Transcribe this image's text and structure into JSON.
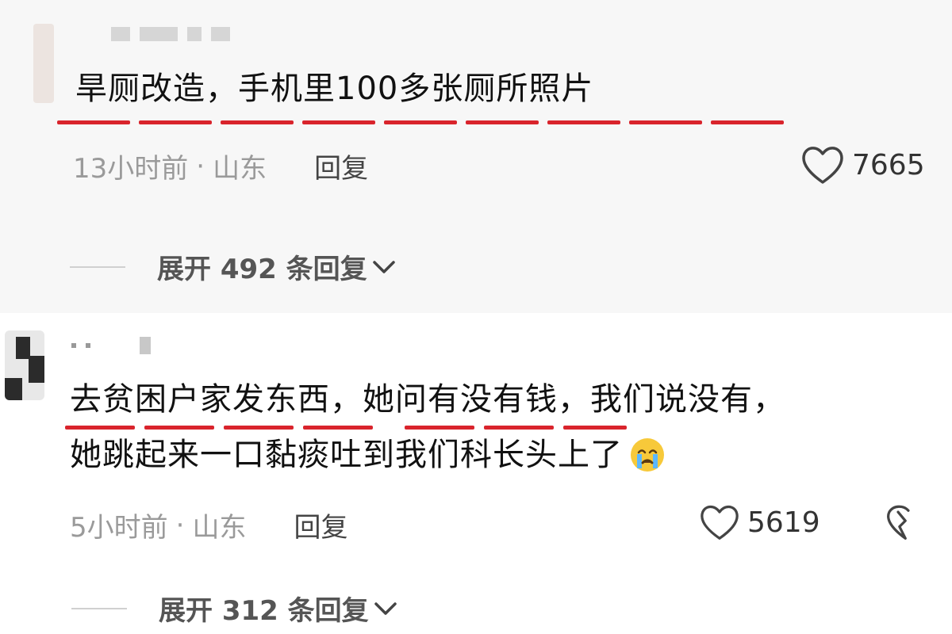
{
  "comments": [
    {
      "text": "旱厕改造，手机里100多张厕所照片",
      "time": "13小时前",
      "location": "山东",
      "separator": "·",
      "reply_label": "回复",
      "likes": "7665",
      "expand_label": "展开 492 条回复"
    },
    {
      "line1": "去贫困户家发东西，她问有没有钱，我们说没有，",
      "line2": "她跳起来一口黏痰吐到我们科长头上了",
      "emoji": "crying-face-emoji",
      "time": "5小时前",
      "location": "山东",
      "separator": "·",
      "reply_label": "回复",
      "likes": "5619",
      "expand_label": "展开 312 条回复"
    }
  ],
  "colors": {
    "underline": "#d9242c",
    "meta_text": "#9a9a9a",
    "highlight_bg": "#f7f7f7"
  }
}
